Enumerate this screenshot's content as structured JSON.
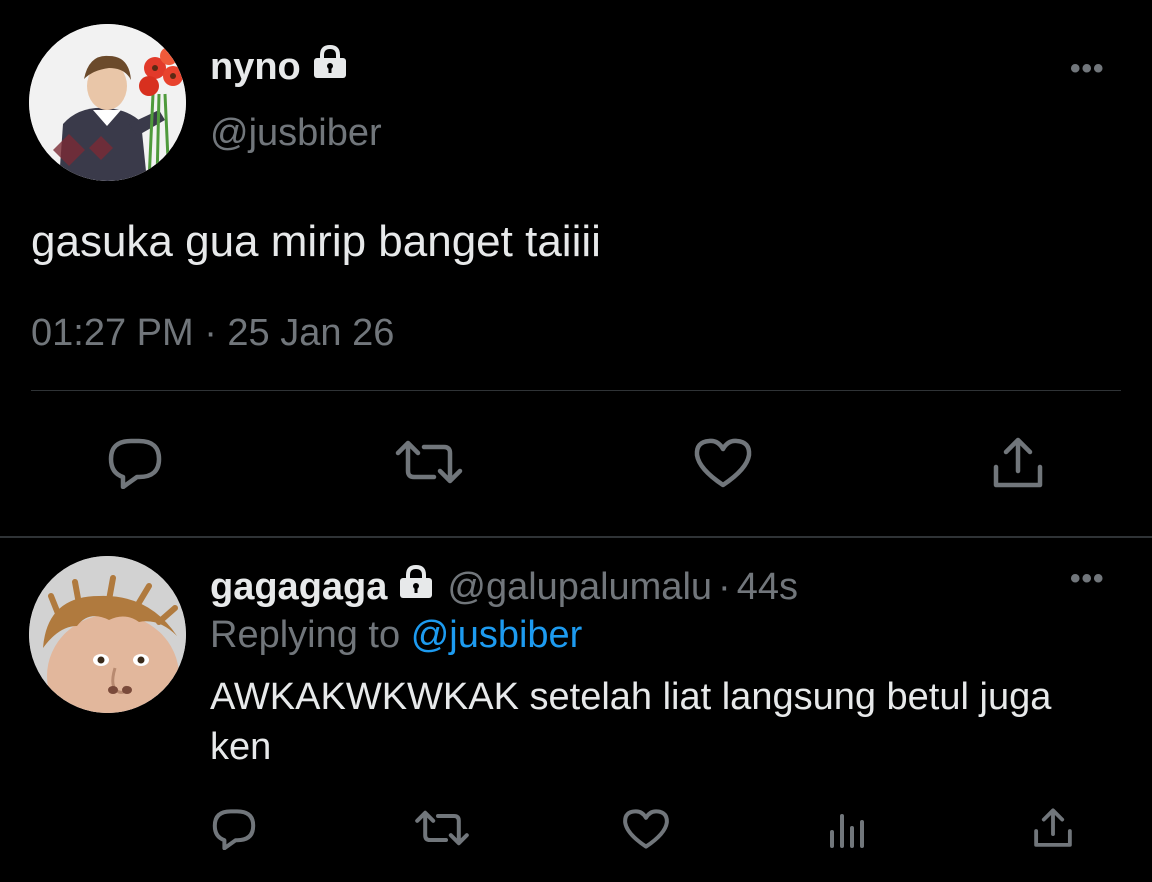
{
  "main_tweet": {
    "display_name": "nyno",
    "handle": "@jusbiber",
    "text": "gasuka gua mirip banget taiiii",
    "timestamp": "01:27 PM · 25 Jan 26",
    "more_label": "•••",
    "icons": [
      "lock-icon",
      "reply-icon",
      "retweet-icon",
      "like-icon",
      "share-icon"
    ]
  },
  "reply_tweet": {
    "display_name": "gagagaga",
    "handle": "@galupalumalu",
    "separator": "·",
    "age": "44s",
    "replying_prefix": "Replying to",
    "replying_mention": "@jusbiber",
    "text": "AWKAKWKWKAK setelah liat langsung betul juga ken",
    "more_label": "•••",
    "icons": [
      "lock-icon",
      "reply-icon",
      "retweet-icon",
      "like-icon",
      "views-icon",
      "share-icon"
    ]
  },
  "colors": {
    "background": "#000000",
    "primary_text": "#e7e9ea",
    "secondary_text": "#71767b",
    "mention": "#1d9bf0",
    "divider": "#2f3336"
  }
}
